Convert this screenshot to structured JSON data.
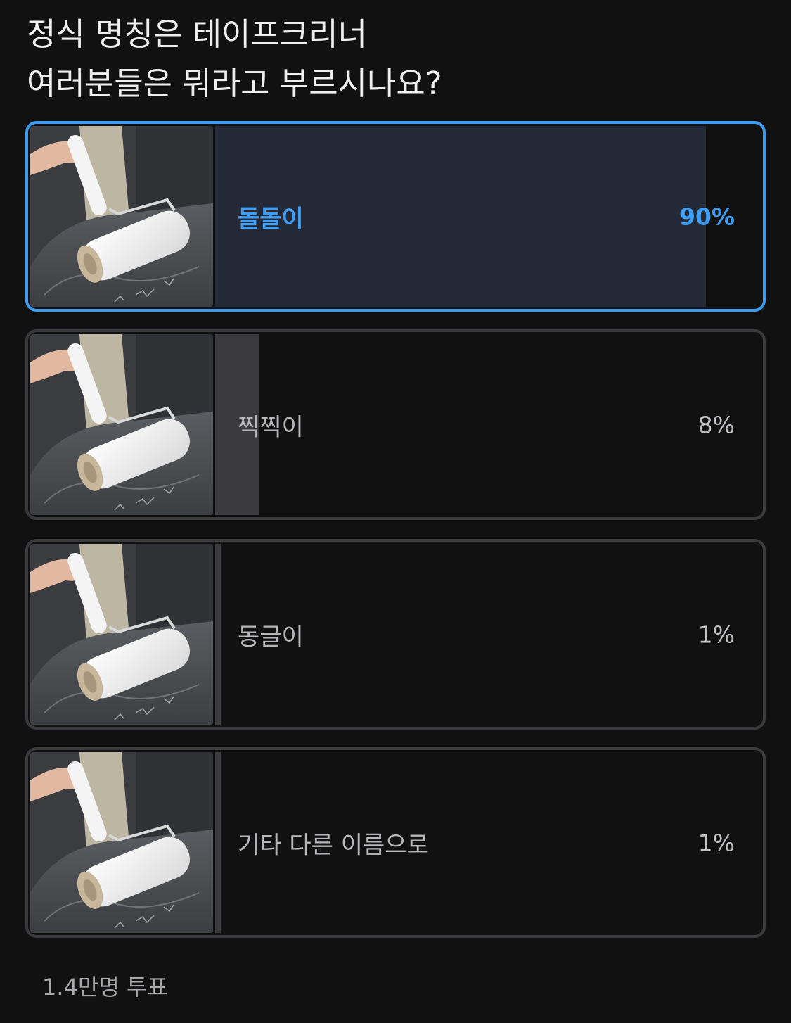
{
  "poll": {
    "question_line1": "정식 명칭은 테이프크리너",
    "question_line2": "여러분들은 뭐라고 부르시나요?",
    "options": [
      {
        "label": "돌돌이",
        "percent_text": "90%",
        "percent": 90,
        "selected": true,
        "image": "lint-roller-image"
      },
      {
        "label": "찍찍이",
        "percent_text": "8%",
        "percent": 8,
        "selected": false,
        "image": "lint-roller-image"
      },
      {
        "label": "동글이",
        "percent_text": "1%",
        "percent": 1,
        "selected": false,
        "image": "lint-roller-image"
      },
      {
        "label": "기타 다른 이름으로",
        "percent_text": "1%",
        "percent": 1,
        "selected": false,
        "image": "lint-roller-image"
      }
    ],
    "vote_count": "1.4만명 투표"
  },
  "colors": {
    "background": "#111112",
    "accent": "#3b9cf2",
    "selected_fill": "#242937",
    "unselected_fill": "#3b3b3d",
    "border": "#3a3a3d"
  }
}
